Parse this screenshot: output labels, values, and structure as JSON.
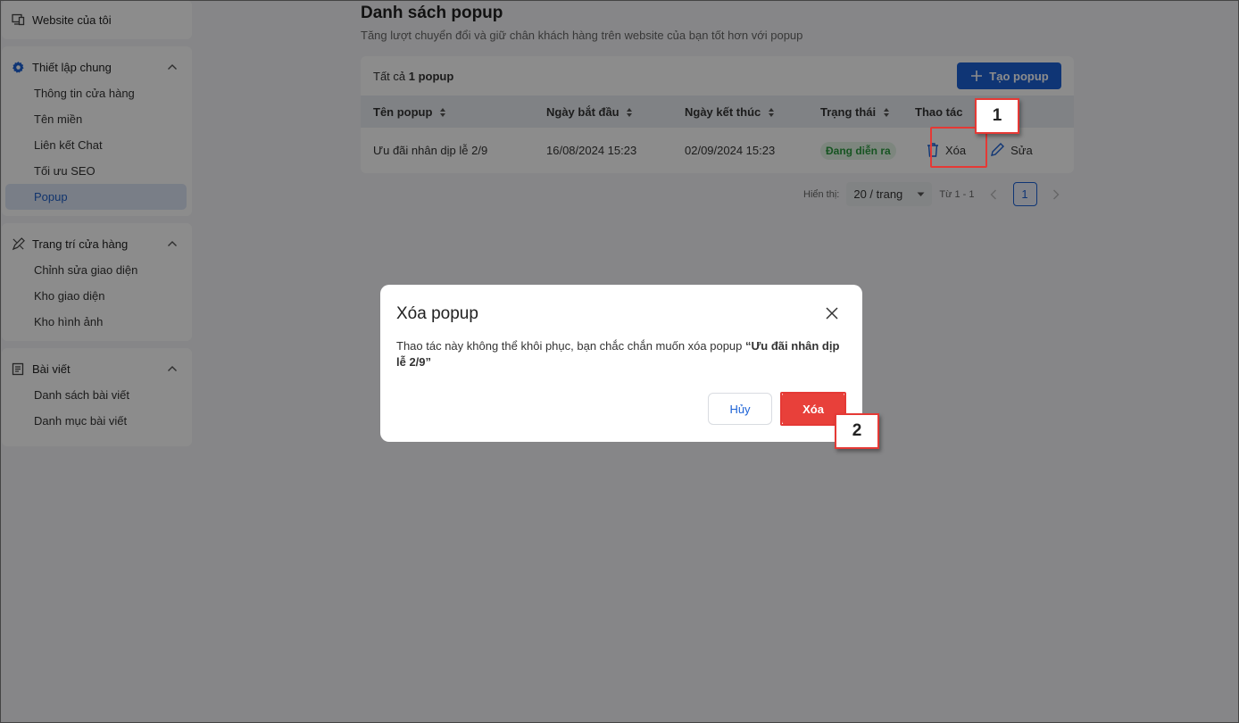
{
  "sidebar": {
    "website": {
      "label": "Website của tôi",
      "icon": "website-icon"
    },
    "general": {
      "title": "Thiết lập chung",
      "icon": "gear-icon",
      "items": [
        "Thông tin cửa hàng",
        "Tên miền",
        "Liên kết Chat",
        "Tối ưu SEO",
        "Popup"
      ]
    },
    "decor": {
      "title": "Trang trí cửa hàng",
      "icon": "paint-tools-icon",
      "items": [
        "Chỉnh sửa giao diện",
        "Kho giao diện",
        "Kho hình ảnh"
      ]
    },
    "posts": {
      "title": "Bài viết",
      "icon": "article-icon",
      "items": [
        "Danh sách bài viết",
        "Danh mục bài viết"
      ]
    },
    "active_item": "Popup"
  },
  "main": {
    "title": "Danh sách popup",
    "subtitle": "Tăng lượt chuyển đổi và giữ chân khách hàng trên website của bạn tốt hơn với popup",
    "count_prefix": "Tất cả",
    "count_value": "1 popup",
    "create_button": "Tạo popup",
    "columns": [
      "Tên popup",
      "Ngày bắt đầu",
      "Ngày kết thúc",
      "Trạng thái",
      "Thao tác"
    ],
    "rows": [
      {
        "name": "Ưu đãi nhân dịp lễ 2/9",
        "start": "16/08/2024 15:23",
        "end": "02/09/2024 15:23",
        "status": "Đang diễn ra",
        "delete_label": "Xóa",
        "edit_label": "Sửa"
      }
    ],
    "pagination": {
      "show_label": "Hiển thị:",
      "page_size": "20 / trang",
      "range": "Từ 1 - 1",
      "current_page": "1"
    }
  },
  "modal": {
    "title": "Xóa popup",
    "message": "Thao tác này không thể khôi phục, bạn chắc chắn muốn xóa popup",
    "target": "“Ưu đãi nhân dịp lễ 2/9”",
    "cancel": "Hủy",
    "confirm": "Xóa"
  },
  "callouts": [
    "1",
    "2"
  ],
  "colors": {
    "primary": "#1c62d6",
    "danger": "#e8403a",
    "success": "#2b9a3e",
    "callout": "#e53935"
  }
}
